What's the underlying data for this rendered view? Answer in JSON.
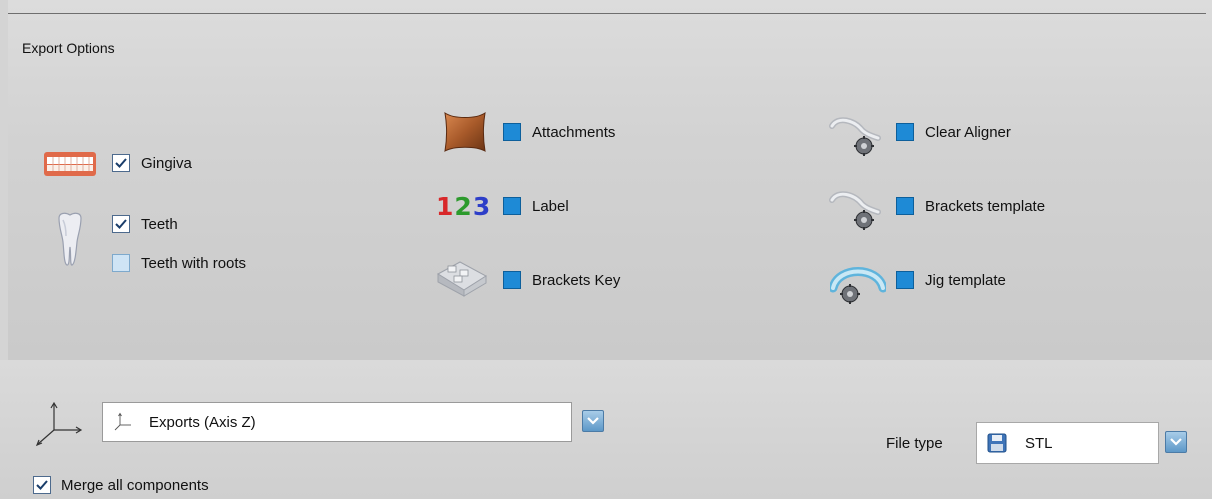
{
  "export_options": {
    "title": "Export Options",
    "gingiva": {
      "label": "Gingiva",
      "checked": true,
      "icon": "gingiva-icon"
    },
    "teeth": {
      "label": "Teeth",
      "checked": true,
      "icon": "tooth-icon"
    },
    "teeth_with_roots": {
      "label": "Teeth with roots",
      "checked": false
    },
    "attachments": {
      "label": "Attachments",
      "checked": false,
      "icon": "attachment-icon"
    },
    "label": {
      "label": "Label",
      "checked": false,
      "icon": "label-123-icon",
      "icon_text": "123"
    },
    "brackets_key": {
      "label": "Brackets Key",
      "checked": false,
      "icon": "brackets-key-icon"
    },
    "clear_aligner": {
      "label": "Clear Aligner",
      "checked": false,
      "icon": "clear-aligner-icon"
    },
    "brackets_template": {
      "label": "Brackets template",
      "checked": false,
      "icon": "brackets-template-icon"
    },
    "jig_template": {
      "label": "Jig template",
      "checked": false,
      "icon": "jig-template-icon"
    }
  },
  "export_settings": {
    "axis_select": {
      "value": "Exports (Axis Z)",
      "icon": "axis-icon"
    },
    "file_type": {
      "label": "File type",
      "value": "STL",
      "icon": "floppy-disk-icon"
    },
    "merge_all": {
      "label": "Merge all components",
      "checked": true
    }
  },
  "colors": {
    "checkbox_blue": "#1e8ad6",
    "label_1": "#d8282a",
    "label_2": "#2c9a2c",
    "label_3": "#2d3ec8"
  }
}
